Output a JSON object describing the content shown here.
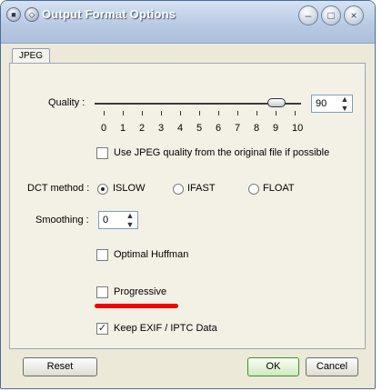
{
  "window": {
    "title": "Output Format Options",
    "controls": [
      "minimize-icon",
      "maximize-icon",
      "close-icon"
    ]
  },
  "tabs": [
    {
      "label": "JPEG",
      "active": true
    }
  ],
  "quality": {
    "label": "Quality :",
    "value": "90",
    "slider_fraction": 0.9,
    "ticks": [
      "0",
      "1",
      "2",
      "3",
      "4",
      "5",
      "6",
      "7",
      "8",
      "9",
      "10"
    ]
  },
  "use_original_quality": {
    "label": "Use JPEG quality from the original file if possible",
    "checked": false
  },
  "dct": {
    "label": "DCT method :",
    "options": [
      {
        "label": "ISLOW",
        "selected": true
      },
      {
        "label": "IFAST",
        "selected": false
      },
      {
        "label": "FLOAT",
        "selected": false
      }
    ]
  },
  "smoothing": {
    "label": "Smoothing :",
    "value": "0"
  },
  "optimal_huffman": {
    "label": "Optimal Huffman",
    "checked": false
  },
  "progressive": {
    "label": "Progressive",
    "checked": false
  },
  "keep_exif": {
    "label": "Keep EXIF / IPTC Data",
    "checked": true,
    "mark": "✓"
  },
  "buttons": {
    "reset": "Reset",
    "ok": "OK",
    "cancel": "Cancel"
  },
  "colors": {
    "annotation_underline": "#f00000",
    "ok_border": "#3f8f2d"
  }
}
